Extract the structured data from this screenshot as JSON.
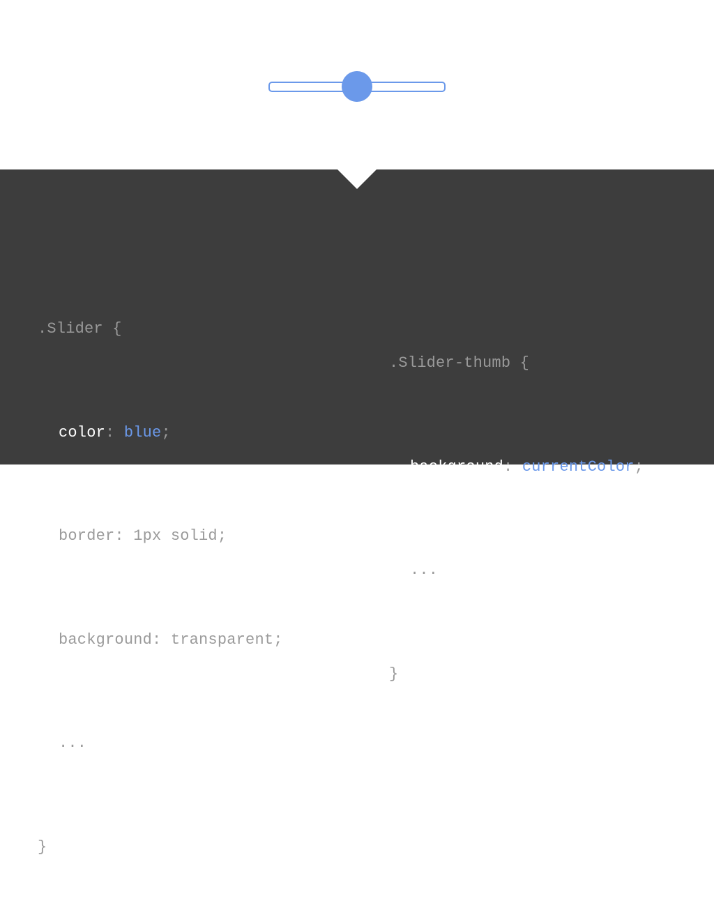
{
  "slider": {
    "value": 0.5,
    "track_color": "#6b99ea",
    "thumb_color": "#6b99ea"
  },
  "colors": {
    "panel_background": "#3d3d3d",
    "code_text": "#9a9a9a",
    "highlight_property": "#ffffff",
    "highlight_value": "#6b99ea"
  },
  "code_left": {
    "open": ".Slider {",
    "color_prop": "color",
    "color_sep": ": ",
    "color_value": "blue",
    "color_end": ";",
    "border": "border: 1px solid;",
    "background": "background: transparent;",
    "ellipsis": "...",
    "close": "}"
  },
  "code_right": {
    "open": ".Slider-thumb {",
    "bg_prop": "background",
    "bg_sep": ": ",
    "bg_value": "currentColor",
    "bg_end": ";",
    "ellipsis": "...",
    "close": "}"
  }
}
